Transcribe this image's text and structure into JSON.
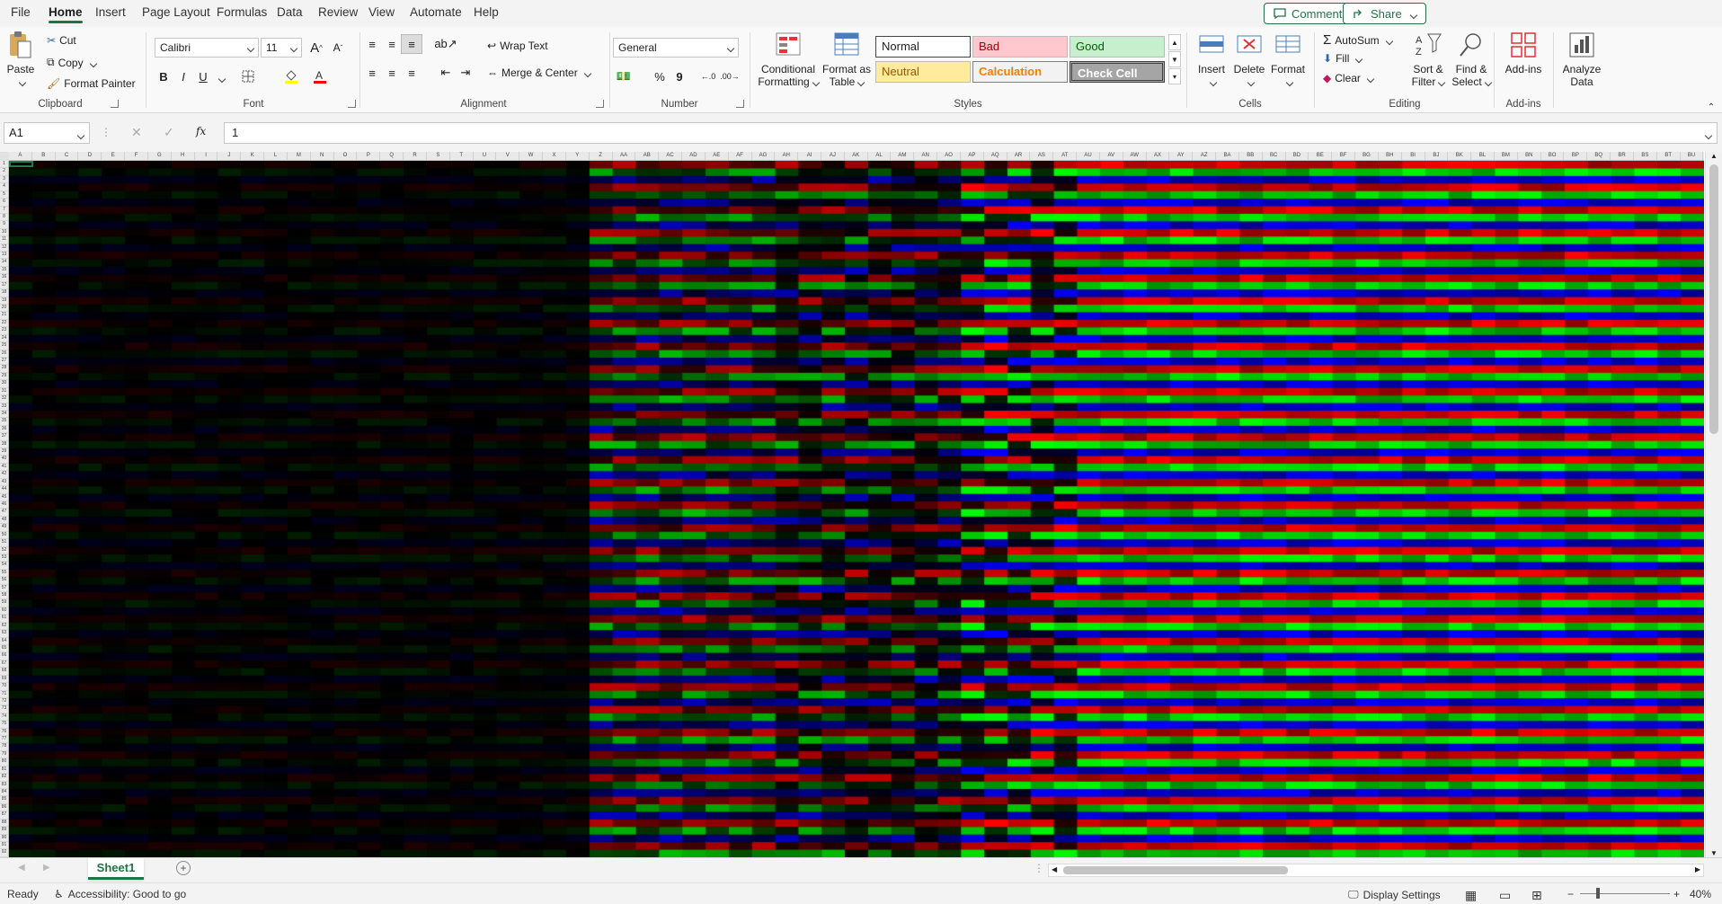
{
  "menu": {
    "tabs": [
      "File",
      "Home",
      "Insert",
      "Page Layout",
      "Formulas",
      "Data",
      "Review",
      "View",
      "Automate",
      "Help"
    ],
    "active": "Home",
    "comments_label": "Comments",
    "share_label": "Share"
  },
  "clipboard": {
    "paste": "Paste",
    "cut": "Cut",
    "copy": "Copy",
    "format_painter": "Format Painter",
    "label": "Clipboard"
  },
  "font": {
    "name": "Calibri",
    "size": "11",
    "grow": "A",
    "shrink": "A",
    "bold": "B",
    "italic": "I",
    "underline": "U",
    "label": "Font"
  },
  "alignment": {
    "wrap_text": "Wrap Text",
    "merge_center": "Merge & Center",
    "label": "Alignment"
  },
  "number": {
    "format": "General",
    "percent": "%",
    "comma": "9",
    "label": "Number"
  },
  "styles": {
    "conditional_1": "Conditional",
    "conditional_2": "Formatting",
    "format_table_1": "Format as",
    "format_table_2": "Table",
    "normal": "Normal",
    "bad": "Bad",
    "good": "Good",
    "neutral": "Neutral",
    "calculation": "Calculation",
    "check_cell": "Check Cell",
    "label": "Styles",
    "colors": {
      "bad_bg": "#ffc7ce",
      "bad_fg": "#9c0006",
      "good_bg": "#c6efce",
      "good_fg": "#006100",
      "neutral_bg": "#ffeb9c",
      "neutral_fg": "#9c5700",
      "calc_bg": "#f2f2f2",
      "calc_fg": "#fa7d00",
      "check_bg": "#a5a5a5"
    }
  },
  "cells_group": {
    "insert": "Insert",
    "delete": "Delete",
    "format": "Format",
    "label": "Cells"
  },
  "editing": {
    "autosum": "AutoSum",
    "fill": "Fill",
    "clear": "Clear",
    "sort_1": "Sort &",
    "sort_2": "Filter",
    "find_1": "Find &",
    "find_2": "Select",
    "label": "Editing"
  },
  "addins": {
    "addins": "Add-ins",
    "label": "Add-ins",
    "analyze_1": "Analyze",
    "analyze_2": "Data"
  },
  "formula_bar": {
    "name_box": "A1",
    "value": "1",
    "fx": "fx"
  },
  "grid": {
    "columns": [
      "A",
      "B",
      "C",
      "D",
      "E",
      "F",
      "G",
      "H",
      "I",
      "J",
      "K",
      "L",
      "M",
      "N",
      "O",
      "P",
      "Q",
      "R",
      "S",
      "T",
      "U",
      "V",
      "W",
      "X",
      "Y",
      "Z",
      "AA",
      "AB",
      "AC",
      "AD",
      "AE",
      "AF",
      "AG",
      "AH",
      "AI",
      "AJ",
      "AK",
      "AL",
      "AM",
      "AN",
      "AO",
      "AP",
      "AQ",
      "AR",
      "AS",
      "AT",
      "AU",
      "AV",
      "AW",
      "AX",
      "AY",
      "AZ",
      "BA",
      "BB",
      "BC",
      "BD",
      "BE",
      "BF",
      "BG",
      "BH",
      "BI",
      "BJ",
      "BK",
      "BL",
      "BM",
      "BN",
      "BO",
      "BP",
      "BQ",
      "BR",
      "BS",
      "BT",
      "BU"
    ],
    "row_count": 92,
    "channel_colors": [
      "#ff0000",
      "#00ff00",
      "#0000ff"
    ]
  },
  "sheets": {
    "active": "Sheet1"
  },
  "status": {
    "ready": "Ready",
    "accessibility": "Accessibility: Good to go",
    "display_settings": "Display Settings",
    "zoom": "40%"
  }
}
